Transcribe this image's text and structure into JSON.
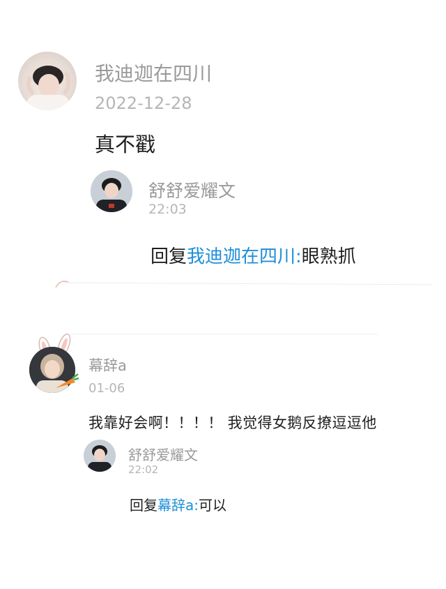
{
  "comments": [
    {
      "username": "我迪迦在四川",
      "date": "2022-12-28",
      "text": "真不戳",
      "reply": {
        "username": "舒舒爱耀文",
        "time": "22:03",
        "prefix": "回复",
        "target": "我迪迦在四川",
        "separator": ":",
        "text": "眼熟抓"
      }
    },
    {
      "username": "幕辞a",
      "date": "01-06",
      "text": "我靠好会啊！！！！ 我觉得女鹅反撩逗逗他",
      "reply": {
        "username": "舒舒爱耀文",
        "time": "22:02",
        "prefix": "回复",
        "target": "幕辞a",
        "separator": ":",
        "text": "可以"
      }
    }
  ],
  "icons": {
    "avatar_1": "user-avatar-photo",
    "avatar_2": "reply-user-avatar-photo",
    "avatar_3": "user-avatar-with-bunny-ears",
    "avatar_4": "reply-user-avatar-photo"
  }
}
